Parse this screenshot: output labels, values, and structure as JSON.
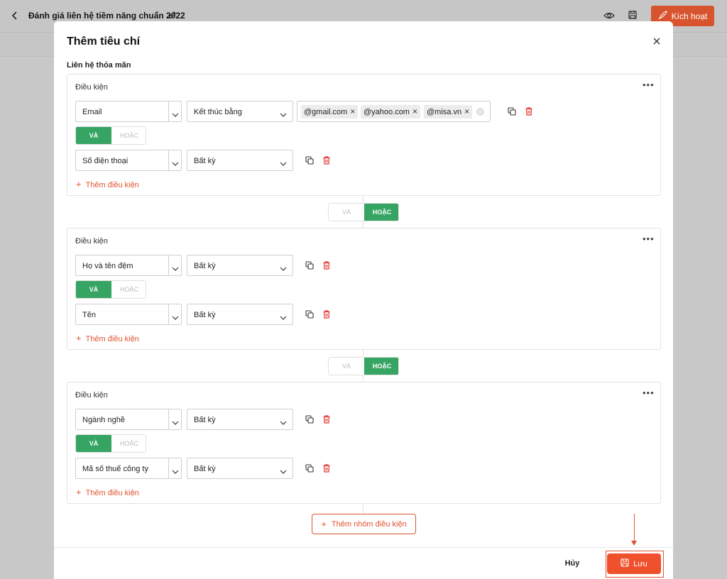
{
  "app": {
    "title": "Đánh giá liên hệ tiềm năng chuẩn 2022",
    "activate_label": "Kích hoạt"
  },
  "modal": {
    "title": "Thêm tiêu chí",
    "section_label": "Liên hệ thỏa mãn",
    "group_label": "Điều kiện",
    "and_label": "VÀ",
    "or_label": "HOẶC",
    "add_condition_label": "Thêm điều kiện",
    "add_group_label": "Thêm nhóm điều kiện",
    "cancel_label": "Hủy",
    "save_label": "Lưu"
  },
  "groups": [
    {
      "conditions": [
        {
          "field": "Email",
          "operator": "Kết thúc bằng",
          "values": [
            "@gmail.com",
            "@yahoo.com",
            "@misa.vn"
          ]
        },
        {
          "field": "Số điện thoại",
          "operator": "Bất kỳ"
        }
      ],
      "inner_logic": "VÀ"
    },
    {
      "conditions": [
        {
          "field": "Họ và tên đệm",
          "operator": "Bất kỳ"
        },
        {
          "field": "Tên",
          "operator": "Bất kỳ"
        }
      ],
      "inner_logic": "VÀ"
    },
    {
      "conditions": [
        {
          "field": "Ngành nghề",
          "operator": "Bất kỳ"
        },
        {
          "field": "Mã số thuế công ty",
          "operator": "Bất kỳ"
        }
      ],
      "inner_logic": "VÀ"
    }
  ],
  "group_logic": [
    "HOẶC",
    "HOẶC"
  ],
  "colors": {
    "accent": "#f0512d",
    "green": "#36a462"
  },
  "icons": [
    "back-icon",
    "edit-icon",
    "eye-icon",
    "save-icon",
    "rocket-icon",
    "close-icon",
    "more-icon",
    "chevron-down-icon",
    "copy-icon",
    "trash-icon",
    "plus-icon"
  ]
}
